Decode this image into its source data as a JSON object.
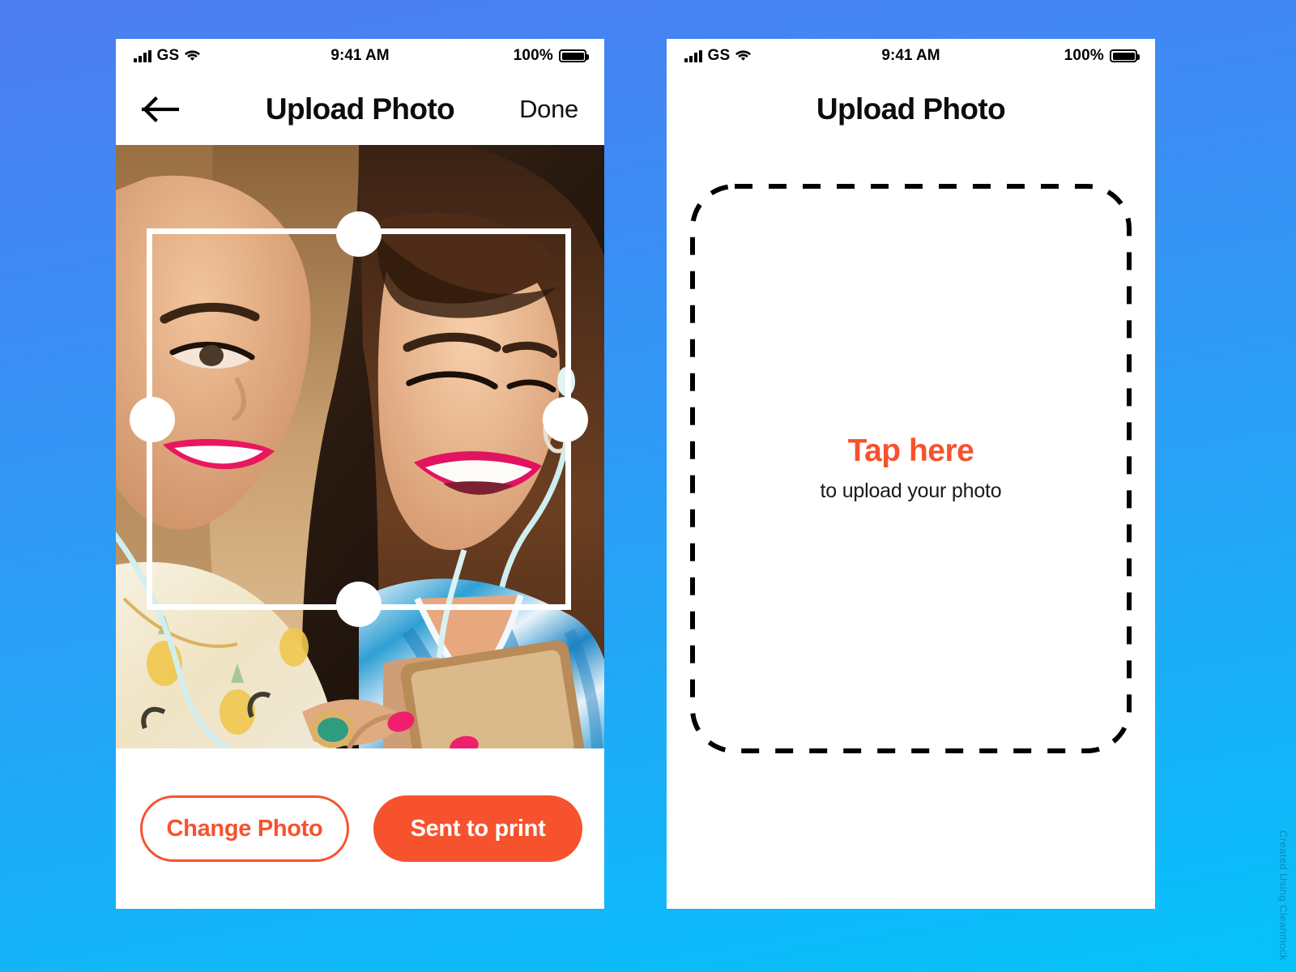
{
  "background": {
    "gradient_from": "#4e7df2",
    "gradient_to": "#05c3fb"
  },
  "theme": {
    "accent": "#F6522E",
    "text_dark": "#0c0c0c"
  },
  "watermark": {
    "text": "Created Using Cleanmock"
  },
  "status_bar": {
    "carrier": "GS",
    "time": "9:41 AM",
    "battery_percent": "100%",
    "signal_icon": "cellular-bars-icon",
    "wifi_icon": "wifi-icon",
    "battery_icon": "battery-full-icon"
  },
  "screen_crop": {
    "nav": {
      "back_icon": "arrow-left-icon",
      "title": "Upload Photo",
      "action_label": "Done"
    },
    "photo": {
      "alt": "two women smiling looking at a phone",
      "crop_handles": [
        "crop-handle-top",
        "crop-handle-right",
        "crop-handle-bottom",
        "crop-handle-left"
      ]
    },
    "buttons": {
      "secondary_label": "Change Photo",
      "primary_label": "Sent to print"
    }
  },
  "screen_upload": {
    "nav": {
      "title": "Upload Photo"
    },
    "dropzone": {
      "title": "Tap here",
      "subtitle": "to upload your photo",
      "border_style": "dashed",
      "border_color": "#000000"
    }
  }
}
